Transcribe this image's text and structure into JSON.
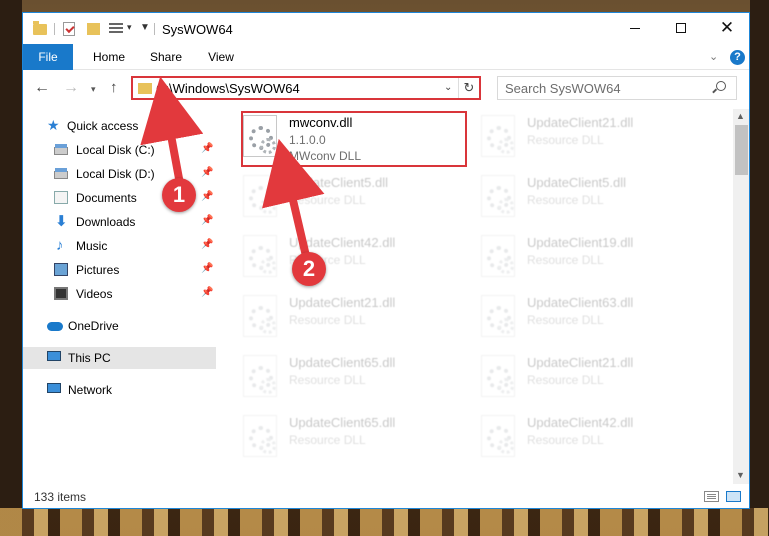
{
  "window": {
    "title": "SysWOW64",
    "minimize_label": "",
    "close_glyph": "✕"
  },
  "ribbon": {
    "tabs": [
      "File",
      "Home",
      "Share",
      "View"
    ],
    "help_glyph": "?"
  },
  "navigation": {
    "address_path": "C:\\Windows\\SysWOW64",
    "search_placeholder": "Search SysWOW64",
    "refresh_glyph": "↻"
  },
  "sidebar": {
    "items": [
      {
        "label": "Quick access",
        "icon": "star-icon",
        "pinned": false
      },
      {
        "label": "Local Disk (C:)",
        "icon": "disk-icon",
        "pinned": true
      },
      {
        "label": "Local Disk (D:)",
        "icon": "disk-icon",
        "pinned": true
      },
      {
        "label": "Documents",
        "icon": "documents-icon",
        "pinned": true
      },
      {
        "label": "Downloads",
        "icon": "download-icon",
        "pinned": true
      },
      {
        "label": "Music",
        "icon": "music-icon",
        "pinned": true
      },
      {
        "label": "Pictures",
        "icon": "pictures-icon",
        "pinned": true
      },
      {
        "label": "Videos",
        "icon": "videos-icon",
        "pinned": true
      },
      {
        "label": "OneDrive",
        "icon": "cloud-icon",
        "pinned": false
      },
      {
        "label": "This PC",
        "icon": "computer-icon",
        "pinned": false,
        "selected": true
      },
      {
        "label": "Network",
        "icon": "network-icon",
        "pinned": false
      }
    ]
  },
  "files": [
    {
      "name": "mwconv.dll",
      "line1": "1.1.0.0",
      "line2": "MWconv DLL",
      "highlighted": true
    },
    {
      "name": "UpdateClient21.dll",
      "line1": "Resource DLL",
      "line2": ""
    },
    {
      "name": "UpdateClient5.dll",
      "line1": "Resource DLL",
      "line2": ""
    },
    {
      "name": "UpdateClient5.dll",
      "line1": "Resource DLL",
      "line2": ""
    },
    {
      "name": "UpdateClient42.dll",
      "line1": "Resource DLL",
      "line2": ""
    },
    {
      "name": "UpdateClient19.dll",
      "line1": "Resource DLL",
      "line2": ""
    },
    {
      "name": "UpdateClient21.dll",
      "line1": "Resource DLL",
      "line2": ""
    },
    {
      "name": "UpdateClient63.dll",
      "line1": "Resource DLL",
      "line2": ""
    },
    {
      "name": "UpdateClient65.dll",
      "line1": "Resource DLL",
      "line2": ""
    },
    {
      "name": "UpdateClient21.dll",
      "line1": "Resource DLL",
      "line2": ""
    },
    {
      "name": "UpdateClient65.dll",
      "line1": "Resource DLL",
      "line2": ""
    },
    {
      "name": "UpdateClient42.dll",
      "line1": "Resource DLL",
      "line2": ""
    }
  ],
  "status": {
    "item_count": "133 items"
  },
  "annotations": {
    "badge_1": "1",
    "badge_2": "2",
    "color": "#e2393d"
  }
}
